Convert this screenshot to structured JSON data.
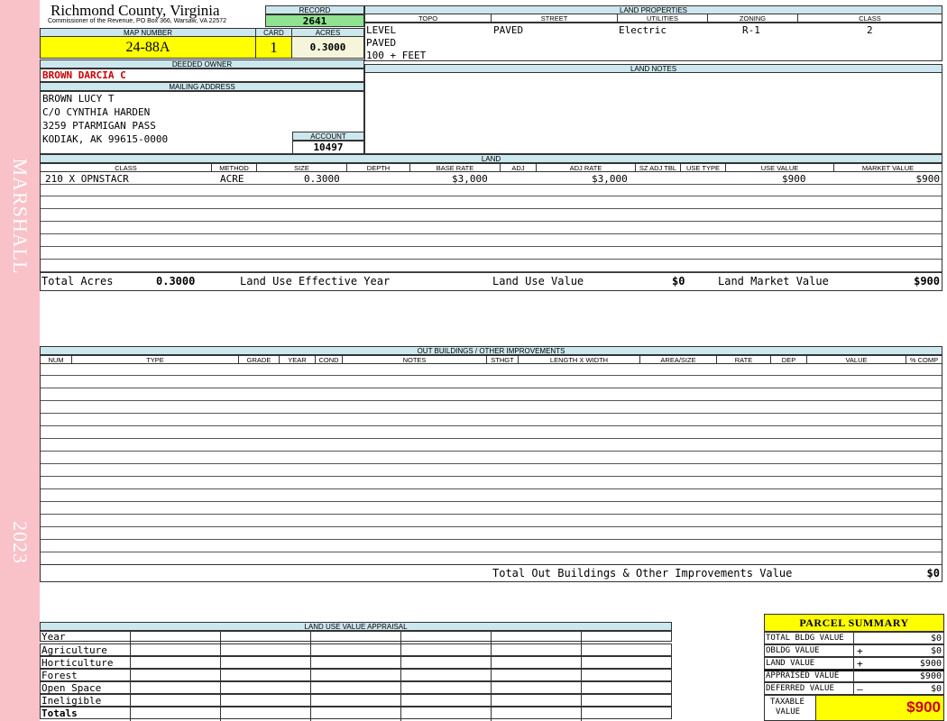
{
  "sidebar": {
    "district": "MARSHALL",
    "year": "2023"
  },
  "header": {
    "county": "Richmond County, Virginia",
    "commissioner": "Commissioner of the Revenue, PO Box 366, Warsaw, VA 22572",
    "record_label": "RECORD",
    "record": "2641",
    "map_number_label": "MAP NUMBER",
    "map_number": "24-88A",
    "card_label": "CARD",
    "card": "1",
    "acres_label": "ACRES",
    "acres": "0.3000"
  },
  "owner": {
    "deeded_owner_label": "DEEDED OWNER",
    "deeded_owner": "BROWN DARCIA C",
    "mailing_label": "MAILING ADDRESS",
    "mailing_lines": [
      "BROWN LUCY T",
      "C/O CYNTHIA HARDEN",
      "3259 PTARMIGAN PASS",
      "KODIAK, AK 99615-0000"
    ],
    "account_label": "ACCOUNT",
    "account": "10497"
  },
  "land_properties": {
    "title": "LAND PROPERTIES",
    "headers": [
      "TOPO",
      "STREET",
      "UTILITIES",
      "ZONING",
      "CLASS"
    ],
    "topo": [
      "LEVEL",
      "PAVED",
      "100 + FEET"
    ],
    "street": "PAVED",
    "utilities": "Electric",
    "zoning": "R-1",
    "class": "2"
  },
  "land_notes": {
    "title": "LAND NOTES"
  },
  "land": {
    "title": "LAND",
    "headers": [
      "CLASS",
      "METHOD",
      "SIZE",
      "DEPTH",
      "BASE RATE",
      "ADJ",
      "ADJ RATE",
      "SZ ADJ TBL",
      "USE TYPE",
      "USE VALUE",
      "MARKET VALUE"
    ],
    "rows": [
      {
        "class": "210 X OPNSTACR",
        "method": "ACRE",
        "size": "0.3000",
        "depth": "",
        "base_rate": "$3,000",
        "adj": "",
        "adj_rate": "$3,000",
        "sz_adj": "",
        "use_type": "",
        "use_value": "$900",
        "market_value": "$900"
      }
    ],
    "totals": {
      "total_acres_label": "Total Acres",
      "total_acres": "0.3000",
      "effective_year_label": "Land Use Effective Year",
      "use_value_label": "Land Use Value",
      "use_value": "$0",
      "market_value_label": "Land Market Value",
      "market_value": "$900"
    }
  },
  "outbuildings": {
    "title": "OUT BUILDINGS / OTHER IMPROVEMENTS",
    "headers": [
      "NUM",
      "TYPE",
      "GRADE",
      "YEAR",
      "COND",
      "NOTES",
      "STHGT",
      "LENGTH X WIDTH",
      "AREA/SIZE",
      "RATE",
      "DEP",
      "VALUE",
      "% COMP"
    ],
    "total_label": "Total Out Buildings & Other Improvements Value",
    "total": "$0"
  },
  "land_use_appraisal": {
    "title": "LAND USE VALUE APPRAISAL",
    "rows": [
      "Year",
      "Agriculture",
      "Horticulture",
      "Forest",
      "Open Space",
      "Ineligible",
      "Totals"
    ]
  },
  "parcel_summary": {
    "title": "PARCEL SUMMARY",
    "rows": [
      {
        "label": "TOTAL BLDG VALUE",
        "sign": "",
        "value": "$0"
      },
      {
        "label": "OBLDG VALUE",
        "sign": "+",
        "value": "$0"
      },
      {
        "label": "LAND VALUE",
        "sign": "+",
        "value": "$900"
      },
      {
        "label": "APPRAISED VALUE",
        "sign": "",
        "value": "$900"
      },
      {
        "label": "DEFERRED VALUE",
        "sign": "–",
        "value": "$0"
      }
    ],
    "taxable_label_1": "TAXABLE",
    "taxable_label_2": "VALUE",
    "taxable": "$900"
  },
  "colors": {
    "sidebar": "#f9c1c8",
    "header_band": "#cde7ee",
    "highlight_yellow": "#ffff00",
    "record_green": "#8fe28f",
    "owner_red": "#cc0000"
  }
}
